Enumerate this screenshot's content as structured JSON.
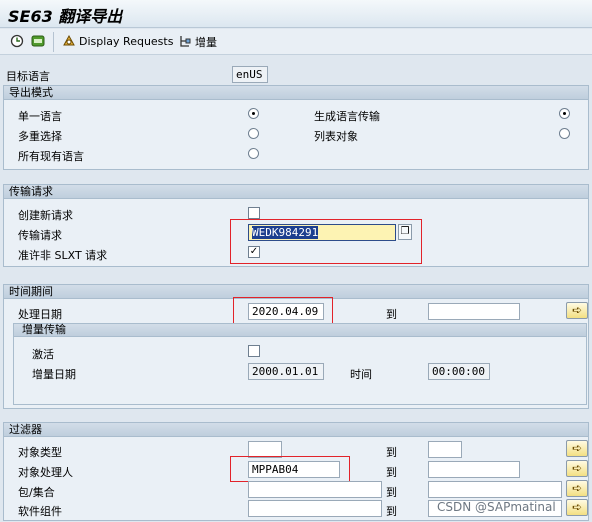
{
  "window": {
    "title": "SE63 翻译导出"
  },
  "toolbar": {
    "execute_icon": "execute-clock-icon",
    "variant_icon": "variant-icon",
    "display_requests_label": "Display Requests",
    "incremental_label": "增量"
  },
  "target_language": {
    "label": "目标语言",
    "value": "enUS"
  },
  "export_mode": {
    "title": "导出模式",
    "options": [
      {
        "label": "单一语言",
        "selected": true
      },
      {
        "label": "多重选择",
        "selected": false
      },
      {
        "label": "所有现有语言",
        "selected": false
      },
      {
        "label": "生成语言传输",
        "selected": true
      },
      {
        "label": "列表对象",
        "selected": false
      }
    ]
  },
  "transport_request": {
    "title": "传输请求",
    "create_new_label": "创建新请求",
    "request_label": "传输请求",
    "request_value": "WEDK984291",
    "allow_non_slxt_label": "准许非 SLXT 请求",
    "allow_non_slxt_checked": "✓"
  },
  "time_period": {
    "title": "时间期间",
    "process_date_label": "处理日期",
    "process_date_value": "2020.04.09",
    "to_label": "到",
    "incremental": {
      "title": "增量传输",
      "activate_label": "激活",
      "date_label": "增量日期",
      "date_value": "2000.01.01",
      "time_label": "时间",
      "time_value": "00:00:00"
    }
  },
  "filter": {
    "title": "过滤器",
    "object_type_label": "对象类型",
    "object_owner_label": "对象处理人",
    "object_owner_value": "MPPAB04",
    "package_label": "包/集合",
    "component_label": "软件组件",
    "to_label": "到"
  },
  "watermark": "CSDN @SAPmatinal",
  "colors": {
    "accent_red": "#e2232a",
    "selected_field": "#fdf3b3",
    "section_bg": "#bfcedd"
  }
}
